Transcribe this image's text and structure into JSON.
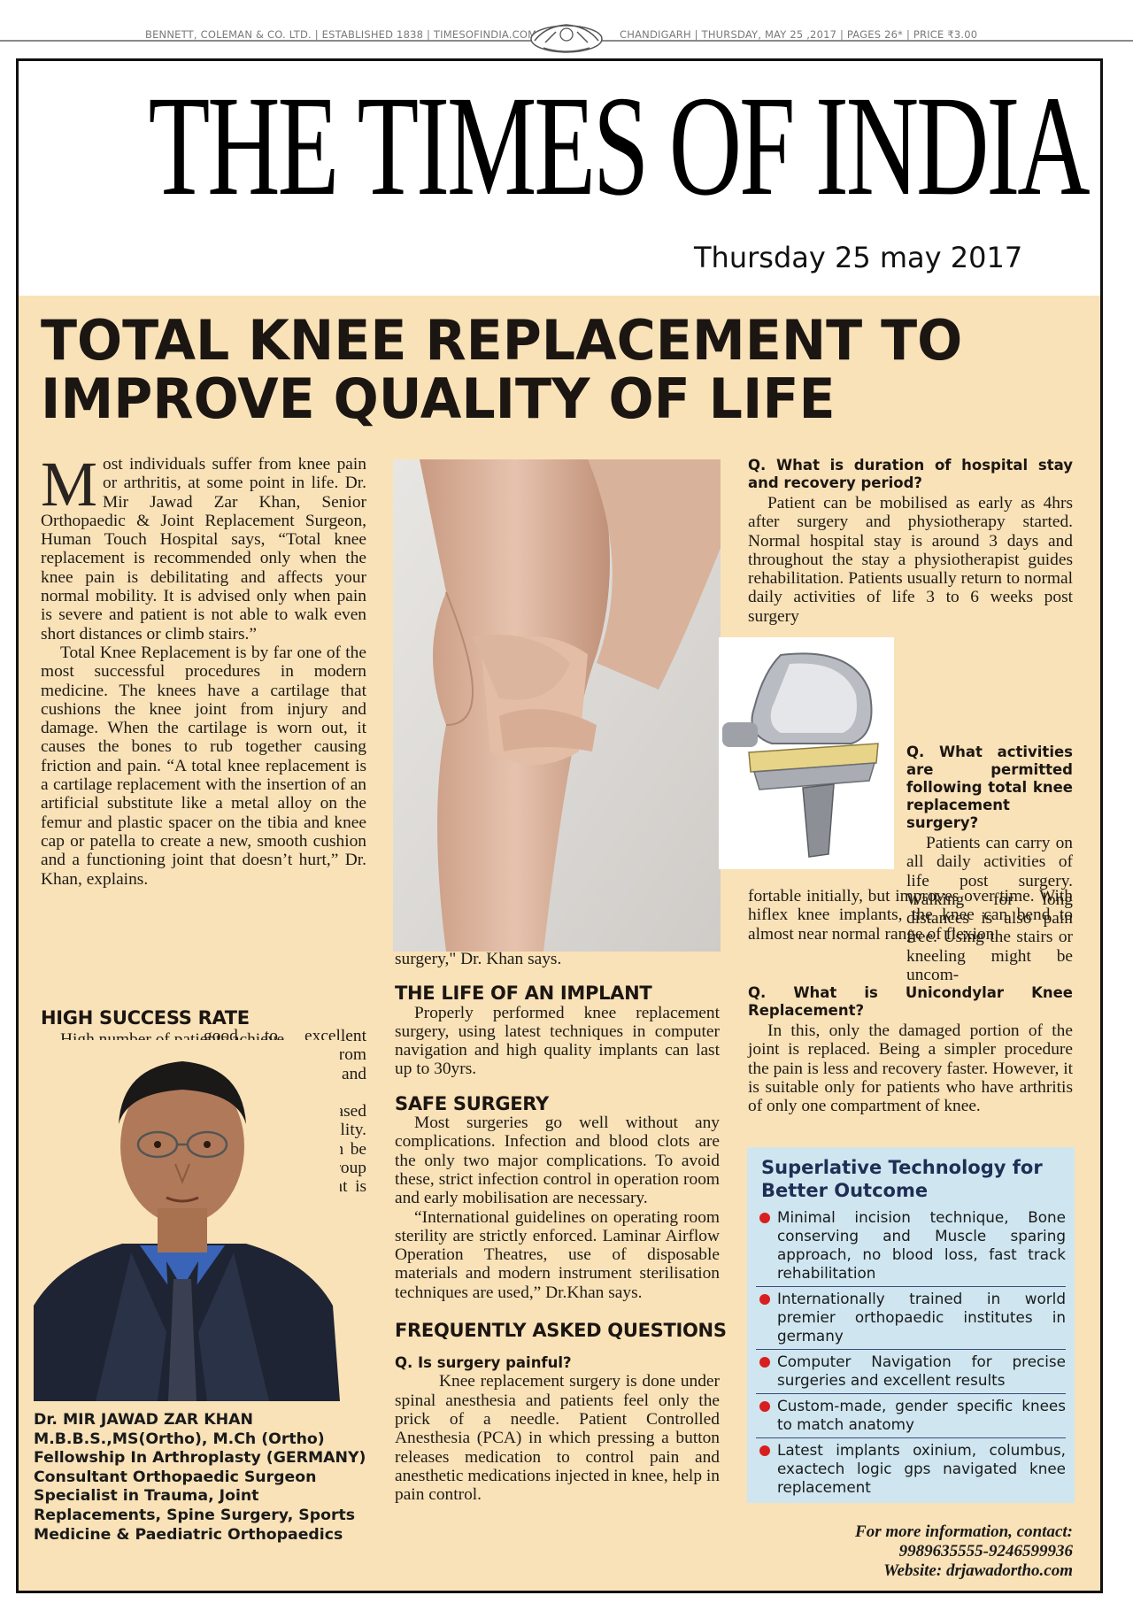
{
  "topline": {
    "left": "BENNETT, COLEMAN & CO. LTD.  |  ESTABLISHED 1838  |  TIMESOFINDIA.COM",
    "right": "CHANDIGARH  | THURSDAY, MAY 25 ,2017 | PAGES 26* |  PRICE ₹3.00"
  },
  "masthead": {
    "title": "THE TIMES OF INDIA",
    "date": "Thursday 25 may 2017"
  },
  "article": {
    "headline_line1": "TOTAL KNEE REPLACEMENT TO",
    "headline_line2": "IMPROVE QUALITY OF LIFE",
    "col1": {
      "dropcap": "M",
      "p1": "ost individuals suffer from knee pain or arthritis, at some point in life. Dr. Mir Jawad Zar Khan, Senior Orthopaedic & Joint Replacement Surgeon, Human Touch Hospital says, “Total knee replacement is recommended only when the knee pain is debilitating and affects your normal mobility. It is advised only when pain is severe and patient is not able to walk even short distances or climb stairs.”",
      "p2": "Total Knee Replacement is by far one of the most successful procedures in modern medicine. The knees have a cartilage that cushions the knee joint from injury and damage.  When the cartilage is worn out, it causes the bones to rub together causing friction and pain. “A total knee replacement is a cartilage replacement with the insertion of an artificial substitute like a metal alloy on the femur and plastic spacer on the tibia and knee cap or patella to create a new, smooth cushion and a functioning joint that doesn’t hurt,” Dr. Khan, explains.",
      "h_success": "HIGH SUCCESS RATE",
      "success_lead": "High number of patients achieve",
      "success_rest": "good to excellent results with relief from discomfort and experience significantly increased activity and mobility. “The procedure can be done in any age group provided the patient is fit for"
    },
    "col2": {
      "tail": "surgery,\" Dr. Khan says.",
      "h_life": "THE LIFE OF AN IMPLANT",
      "life": "Properly performed knee replacement surgery, using latest techniques in computer navigation and high quality implants can last up to 30yrs.",
      "h_safe": "SAFE SURGERY",
      "safe1": "Most surgeries go well without any complications. Infection and blood clots are the only two major complications. To avoid these, strict infection control in operation room and early mobilisation are necessary.",
      "safe2": "“International guidelines on operating room sterility are strictly enforced. Laminar Airflow Operation Theatres, use of disposable materials and modern instrument sterilisation techniques are used,” Dr.Khan says.",
      "h_faq": "FREQUENTLY ASKED QUESTIONS",
      "q1": "Q. Is surgery painful?",
      "a1": "Knee replacement surgery is done under spinal anesthesia and patients feel only the prick of a needle. Patient Controlled Anesthesia (PCA) in which pressing a button releases medication to control pain and anesthetic medications injected in knee, help in pain control."
    },
    "col3": {
      "q2": "Q. What is duration of hospital stay and recovery period?",
      "a2": "Patient can be mobilised as early as 4hrs after surgery and physiotherapy started. Normal hospital stay is around 3 days and throughout the stay a physiotherapist guides rehabilitation. Patients usually return to normal daily activities of life 3 to 6 weeks post surgery",
      "q3": "Q. What activities are permitted following total knee replacement surgery?",
      "a3_narrow": "Patients can carry on all daily activities of life post surgery. Walking for long distances is also pain free. Using the stairs or kneeling might be uncom-",
      "a3_wide": "fortable initially, but improves over time. With hiflex knee implants, the knee can bend to almost near normal range of flexion.",
      "q4": "Q. What is Unicondylar Knee Replacement?",
      "a4": "In this, only the damaged portion of the joint is replaced. Being a simpler procedure the pain is less and recovery faster. However, it is suitable only for patients who have arthritis of only one compartment of knee."
    }
  },
  "tech_box": {
    "title": "Superlative Technology for Better Outcome",
    "items": [
      "Minimal incision technique, Bone conserving and Muscle sparing approach, no blood loss, fast track rehabilitation",
      "Internationally trained in world premier orthopaedic institutes in germany",
      "Computer Navigation for precise surgeries and excellent results",
      "Custom-made, gender specific knees to match anatomy",
      "Latest implants oxinium, columbus, exactech logic gps navigated knee replacement"
    ],
    "bullet_color": "#d81e1e"
  },
  "doctor": {
    "name": "Dr. MIR JAWAD ZAR KHAN",
    "degrees": "M.B.B.S.,MS(Ortho), M.Ch (Ortho)",
    "fellowship": "Fellowship In Arthroplasty (GERMANY)",
    "role": "Consultant Orthopaedic Surgeon",
    "specialist": "Specialist in Trauma, Joint Replacements, Spine Surgery, Sports Medicine & Paediatric Orthopaedics"
  },
  "contact": {
    "line1": "For more information, contact:",
    "phones": "9989635555-9246599936",
    "website": "Website: drjawadortho.com"
  },
  "colors": {
    "background": "#f9e2b8",
    "box": "#cfe6f0",
    "box_title": "#1f2e55"
  }
}
